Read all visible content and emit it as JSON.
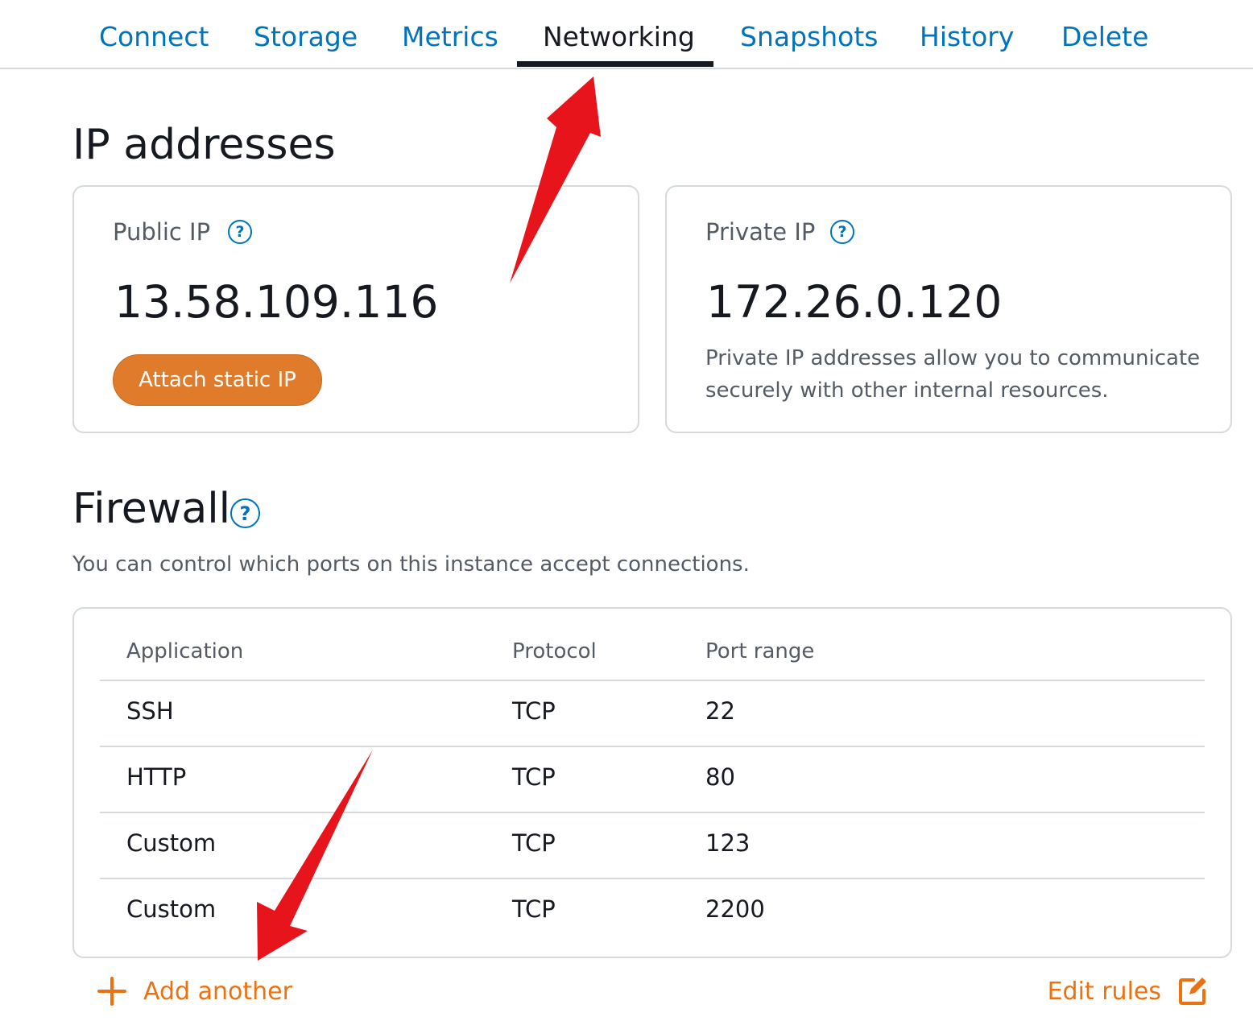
{
  "tabs": [
    {
      "label": "Connect",
      "active": false
    },
    {
      "label": "Storage",
      "active": false
    },
    {
      "label": "Metrics",
      "active": false
    },
    {
      "label": "Networking",
      "active": true
    },
    {
      "label": "Snapshots",
      "active": false
    },
    {
      "label": "History",
      "active": false
    },
    {
      "label": "Delete",
      "active": false
    }
  ],
  "ip_section": {
    "title": "IP addresses",
    "public": {
      "label": "Public IP",
      "value": "13.58.109.116",
      "button_label": "Attach static IP",
      "help_icon": "question-circle-icon"
    },
    "private": {
      "label": "Private IP",
      "value": "172.26.0.120",
      "description": "Private IP addresses allow you to communicate securely with other internal resources.",
      "help_icon": "question-circle-icon"
    }
  },
  "firewall": {
    "title": "Firewall",
    "subtitle": "You can control which ports on this instance accept connections.",
    "columns": [
      "Application",
      "Protocol",
      "Port range"
    ],
    "rows": [
      {
        "application": "SSH",
        "protocol": "TCP",
        "port_range": "22"
      },
      {
        "application": "HTTP",
        "protocol": "TCP",
        "port_range": "80"
      },
      {
        "application": "Custom",
        "protocol": "TCP",
        "port_range": "123"
      },
      {
        "application": "Custom",
        "protocol": "TCP",
        "port_range": "2200"
      }
    ],
    "add_label": "Add another",
    "edit_label": "Edit rules"
  },
  "help_glyph": "?",
  "colors": {
    "link": "#0073bb",
    "accent": "#ec7211",
    "button": "#e07b2c",
    "annotation_arrow": "#e8141b"
  }
}
